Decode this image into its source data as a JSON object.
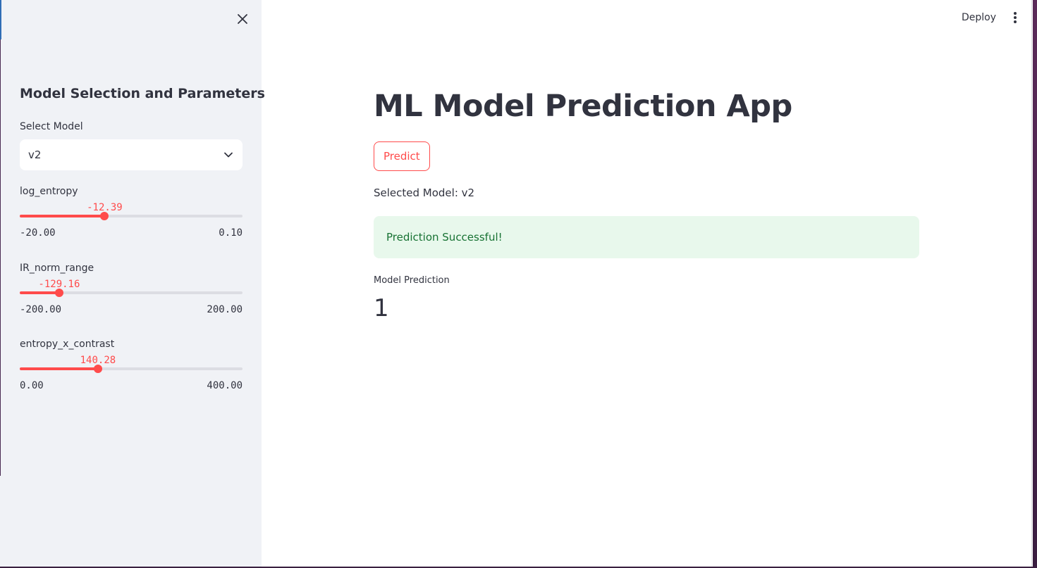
{
  "header": {
    "deploy_label": "Deploy"
  },
  "sidebar": {
    "title": "Model Selection and Parameters",
    "select": {
      "label": "Select Model",
      "value": "v2"
    },
    "sliders": [
      {
        "label": "log_entropy",
        "value": "-12.39",
        "min": "-20.00",
        "max": "0.10",
        "fraction": 0.381
      },
      {
        "label": "IR_norm_range",
        "value": "-129.16",
        "min": "-200.00",
        "max": "200.00",
        "fraction": 0.177
      },
      {
        "label": "entropy_x_contrast",
        "value": "140.28",
        "min": "0.00",
        "max": "400.00",
        "fraction": 0.351
      }
    ]
  },
  "main": {
    "title": "ML Model Prediction App",
    "predict_label": "Predict",
    "selected_model_text": "Selected Model: v2",
    "success_message": "Prediction Successful!",
    "metric": {
      "label": "Model Prediction",
      "value": "1"
    }
  },
  "colors": {
    "accent": "#ff4b4b",
    "sidebar_bg": "#f0f2f6",
    "success_bg": "#e8f8ec",
    "success_text": "#177233",
    "text": "#31333f"
  },
  "icons": {
    "close": "close-icon",
    "chevron": "chevron-down-icon",
    "menu": "kebab-menu-icon"
  }
}
